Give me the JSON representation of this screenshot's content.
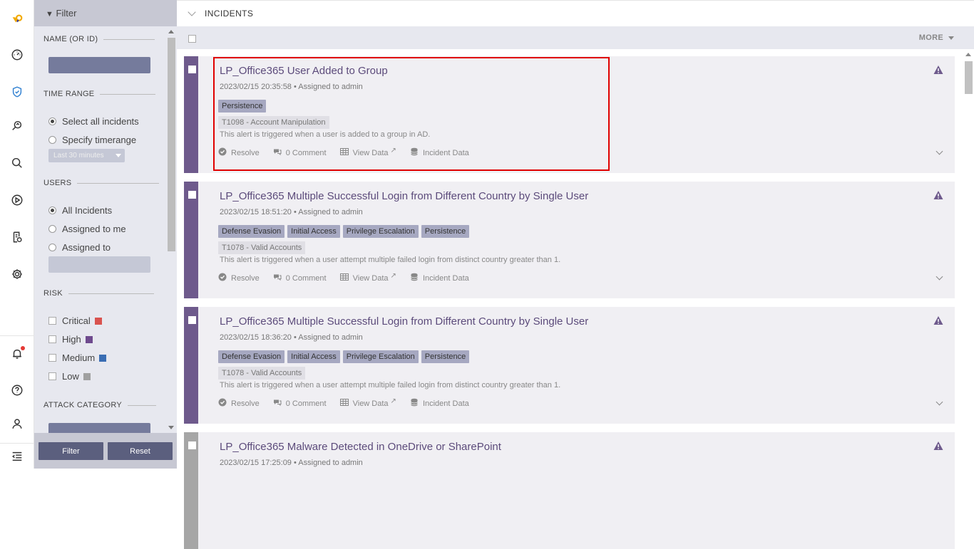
{
  "filter": {
    "header": "Filter",
    "sections": {
      "name": "NAME (OR ID)",
      "time_range": "TIME RANGE",
      "users": "USERS",
      "risk": "RISK",
      "attack_category": "ATTACK CATEGORY"
    },
    "time_options": [
      "Select all incidents",
      "Specify timerange"
    ],
    "time_select": "Last 30 minutes",
    "user_options": [
      "All Incidents",
      "Assigned to me",
      "Assigned to"
    ],
    "risk_levels": [
      {
        "label": "Critical",
        "color": "#d9534f"
      },
      {
        "label": "High",
        "color": "#6e4a8e"
      },
      {
        "label": "Medium",
        "color": "#3a6db3"
      },
      {
        "label": "Low",
        "color": "#a0a0a0"
      }
    ],
    "buttons": {
      "filter": "Filter",
      "reset": "Reset"
    }
  },
  "main": {
    "title": "INCIDENTS",
    "more_label": "MORE"
  },
  "action_labels": {
    "resolve": "Resolve",
    "comment": "0 Comment",
    "view_data": "View Data",
    "incident_data": "Incident Data"
  },
  "incidents": [
    {
      "title": "LP_Office365 User Added to Group",
      "meta": "2023/02/15 20:35:58 • Assigned to admin",
      "tags": [
        "Persistence"
      ],
      "technique": "T1098 - Account Manipulation",
      "description": "This alert is triggered when a user is added to a group in AD.",
      "stripe_color": "#6e5a8c"
    },
    {
      "title": "LP_Office365 Multiple Successful Login from Different Country by Single User",
      "meta": "2023/02/15 18:51:20 • Assigned to admin",
      "tags": [
        "Defense Evasion",
        "Initial Access",
        "Privilege Escalation",
        "Persistence"
      ],
      "technique": "T1078 - Valid Accounts",
      "description": "This alert is triggered when a user attempt multiple failed login from distinct country greater than 1.",
      "stripe_color": "#6e5a8c"
    },
    {
      "title": "LP_Office365 Multiple Successful Login from Different Country by Single User",
      "meta": "2023/02/15 18:36:20 • Assigned to admin",
      "tags": [
        "Defense Evasion",
        "Initial Access",
        "Privilege Escalation",
        "Persistence"
      ],
      "technique": "T1078 - Valid Accounts",
      "description": "This alert is triggered when a user attempt multiple failed login from distinct country greater than 1.",
      "stripe_color": "#6e5a8c"
    },
    {
      "title": "LP_Office365 Malware Detected in OneDrive or SharePoint",
      "meta": "2023/02/15 17:25:09 • Assigned to admin",
      "tags": [],
      "technique": "",
      "description": "",
      "stripe_color": "#a6a6a6"
    }
  ]
}
